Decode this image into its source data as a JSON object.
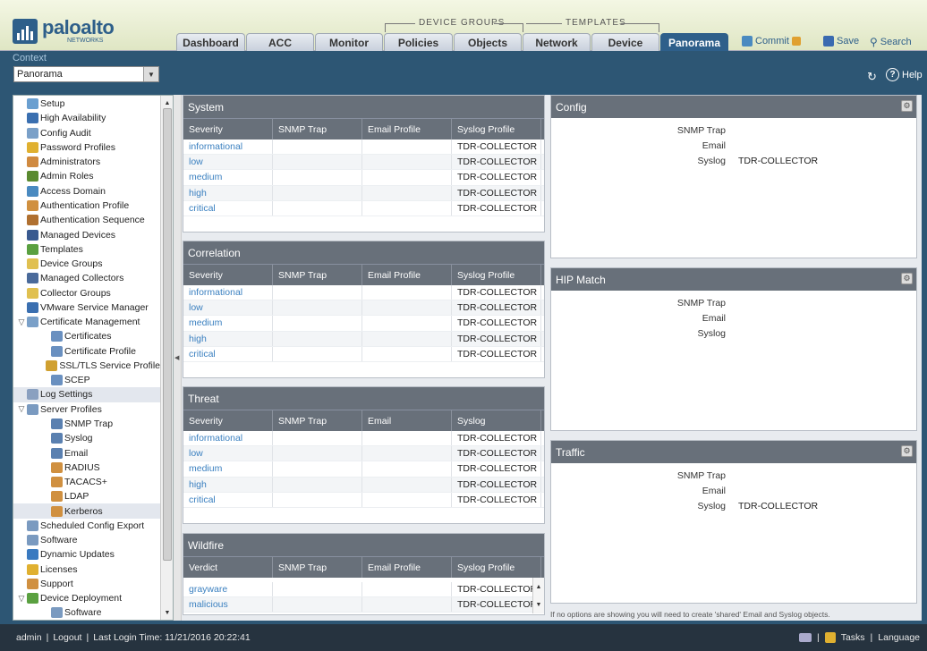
{
  "brand": {
    "name": "paloalto",
    "sub": "NETWORKS"
  },
  "tab_groups": {
    "device_groups": "DEVICE GROUPS",
    "templates": "TEMPLATES"
  },
  "tabs": [
    {
      "label": "Dashboard"
    },
    {
      "label": "ACC"
    },
    {
      "label": "Monitor"
    },
    {
      "label": "Policies"
    },
    {
      "label": "Objects"
    },
    {
      "label": "Network"
    },
    {
      "label": "Device"
    },
    {
      "label": "Panorama",
      "active": true
    }
  ],
  "toolbar": {
    "commit": "Commit",
    "save": "Save",
    "search": "Search"
  },
  "context": {
    "label": "Context",
    "value": "Panorama"
  },
  "help": "Help",
  "sidebar": {
    "items": [
      {
        "label": "Setup",
        "icon": "setup-icon",
        "indent": 0,
        "color": "#6a9fd0"
      },
      {
        "label": "High Availability",
        "icon": "ha-icon",
        "indent": 0,
        "color": "#3a6fb0"
      },
      {
        "label": "Config Audit",
        "icon": "audit-icon",
        "indent": 0,
        "color": "#7aa0c8"
      },
      {
        "label": "Password Profiles",
        "icon": "password-icon",
        "indent": 0,
        "color": "#e0b030"
      },
      {
        "label": "Administrators",
        "icon": "admin-icon",
        "indent": 0,
        "color": "#d08a40"
      },
      {
        "label": "Admin Roles",
        "icon": "roles-icon",
        "indent": 0,
        "color": "#5a8a30"
      },
      {
        "label": "Access Domain",
        "icon": "domain-icon",
        "indent": 0,
        "color": "#4a8ac0"
      },
      {
        "label": "Authentication Profile",
        "icon": "auth-profile-icon",
        "indent": 0,
        "color": "#d09040"
      },
      {
        "label": "Authentication Sequence",
        "icon": "auth-seq-icon",
        "indent": 0,
        "color": "#b07030"
      },
      {
        "label": "Managed Devices",
        "icon": "devices-icon",
        "indent": 0,
        "color": "#3a5a90"
      },
      {
        "label": "Templates",
        "icon": "templates-icon",
        "indent": 0,
        "color": "#5aa040"
      },
      {
        "label": "Device Groups",
        "icon": "device-groups-icon",
        "indent": 0,
        "color": "#e0c050"
      },
      {
        "label": "Managed Collectors",
        "icon": "collectors-icon",
        "indent": 0,
        "color": "#4a6a9a"
      },
      {
        "label": "Collector Groups",
        "icon": "collector-groups-icon",
        "indent": 0,
        "color": "#e0c050"
      },
      {
        "label": "VMware Service Manager",
        "icon": "vmware-icon",
        "indent": 0,
        "color": "#3a6fb0"
      },
      {
        "label": "Certificate Management",
        "icon": "cert-mgmt-icon",
        "indent": 0,
        "color": "#7aa0c8",
        "expanded": true
      },
      {
        "label": "Certificates",
        "icon": "certificate-icon",
        "indent": 1,
        "color": "#6a90c0"
      },
      {
        "label": "Certificate Profile",
        "icon": "cert-profile-icon",
        "indent": 1,
        "color": "#6a90c0"
      },
      {
        "label": "SSL/TLS Service Profile",
        "icon": "lock-icon",
        "indent": 1,
        "color": "#d0a030"
      },
      {
        "label": "SCEP",
        "icon": "scep-icon",
        "indent": 1,
        "color": "#6a90c0"
      },
      {
        "label": "Log Settings",
        "icon": "log-settings-icon",
        "indent": 0,
        "color": "#8aa0c0",
        "selected": true
      },
      {
        "label": "Server Profiles",
        "icon": "server-profiles-icon",
        "indent": 0,
        "color": "#7a9ac0",
        "expanded": true
      },
      {
        "label": "SNMP Trap",
        "icon": "snmp-icon",
        "indent": 1,
        "color": "#5a80b0"
      },
      {
        "label": "Syslog",
        "icon": "syslog-icon",
        "indent": 1,
        "color": "#5a80b0"
      },
      {
        "label": "Email",
        "icon": "email-icon",
        "indent": 1,
        "color": "#5a80b0"
      },
      {
        "label": "RADIUS",
        "icon": "radius-icon",
        "indent": 1,
        "color": "#d09040"
      },
      {
        "label": "TACACS+",
        "icon": "tacacs-icon",
        "indent": 1,
        "color": "#d09040"
      },
      {
        "label": "LDAP",
        "icon": "ldap-icon",
        "indent": 1,
        "color": "#d09040"
      },
      {
        "label": "Kerberos",
        "icon": "kerberos-icon",
        "indent": 1,
        "color": "#d09040",
        "selected": true
      },
      {
        "label": "Scheduled Config Export",
        "icon": "export-icon",
        "indent": 0,
        "color": "#7a9ac0"
      },
      {
        "label": "Software",
        "icon": "software-icon",
        "indent": 0,
        "color": "#7a9ac0"
      },
      {
        "label": "Dynamic Updates",
        "icon": "updates-icon",
        "indent": 0,
        "color": "#3a7ac0"
      },
      {
        "label": "Licenses",
        "icon": "licenses-icon",
        "indent": 0,
        "color": "#e0b030"
      },
      {
        "label": "Support",
        "icon": "support-icon",
        "indent": 0,
        "color": "#d09040"
      },
      {
        "label": "Device Deployment",
        "icon": "deployment-icon",
        "indent": 0,
        "color": "#5aa040",
        "expanded": true
      },
      {
        "label": "Software",
        "icon": "software-icon",
        "indent": 1,
        "color": "#7a9ac0"
      }
    ]
  },
  "panels": {
    "system": {
      "title": "System",
      "columns": [
        "Severity",
        "SNMP Trap",
        "Email Profile",
        "Syslog Profile"
      ],
      "rows": [
        {
          "severity": "informational",
          "snmp": "",
          "email": "",
          "syslog": "TDR-COLLECTOR"
        },
        {
          "severity": "low",
          "snmp": "",
          "email": "",
          "syslog": "TDR-COLLECTOR"
        },
        {
          "severity": "medium",
          "snmp": "",
          "email": "",
          "syslog": "TDR-COLLECTOR"
        },
        {
          "severity": "high",
          "snmp": "",
          "email": "",
          "syslog": "TDR-COLLECTOR"
        },
        {
          "severity": "critical",
          "snmp": "",
          "email": "",
          "syslog": "TDR-COLLECTOR"
        }
      ]
    },
    "correlation": {
      "title": "Correlation",
      "columns": [
        "Severity",
        "SNMP Trap",
        "Email Profile",
        "Syslog Profile"
      ],
      "rows": [
        {
          "severity": "informational",
          "snmp": "",
          "email": "",
          "syslog": "TDR-COLLECTOR"
        },
        {
          "severity": "low",
          "snmp": "",
          "email": "",
          "syslog": "TDR-COLLECTOR"
        },
        {
          "severity": "medium",
          "snmp": "",
          "email": "",
          "syslog": "TDR-COLLECTOR"
        },
        {
          "severity": "high",
          "snmp": "",
          "email": "",
          "syslog": "TDR-COLLECTOR"
        },
        {
          "severity": "critical",
          "snmp": "",
          "email": "",
          "syslog": "TDR-COLLECTOR"
        }
      ]
    },
    "threat": {
      "title": "Threat",
      "columns": [
        "Severity",
        "SNMP Trap",
        "Email",
        "Syslog"
      ],
      "rows": [
        {
          "severity": "informational",
          "snmp": "",
          "email": "",
          "syslog": "TDR-COLLECTOR"
        },
        {
          "severity": "low",
          "snmp": "",
          "email": "",
          "syslog": "TDR-COLLECTOR"
        },
        {
          "severity": "medium",
          "snmp": "",
          "email": "",
          "syslog": "TDR-COLLECTOR"
        },
        {
          "severity": "high",
          "snmp": "",
          "email": "",
          "syslog": "TDR-COLLECTOR"
        },
        {
          "severity": "critical",
          "snmp": "",
          "email": "",
          "syslog": "TDR-COLLECTOR"
        }
      ]
    },
    "wildfire": {
      "title": "Wildfire",
      "columns": [
        "Verdict",
        "SNMP Trap",
        "Email Profile",
        "Syslog Profile"
      ],
      "rows": [
        {
          "severity": "grayware",
          "snmp": "",
          "email": "",
          "syslog": "TDR-COLLECTOR"
        },
        {
          "severity": "malicious",
          "snmp": "",
          "email": "",
          "syslog": "TDR-COLLECTOR"
        }
      ]
    },
    "config": {
      "title": "Config",
      "labels": [
        "SNMP Trap",
        "Email",
        "Syslog"
      ],
      "values": [
        "",
        "",
        "TDR-COLLECTOR"
      ]
    },
    "hip": {
      "title": "HIP Match",
      "labels": [
        "SNMP Trap",
        "Email",
        "Syslog"
      ],
      "values": [
        "",
        "",
        ""
      ]
    },
    "traffic": {
      "title": "Traffic",
      "labels": [
        "SNMP Trap",
        "Email",
        "Syslog"
      ],
      "values": [
        "",
        "",
        "TDR-COLLECTOR"
      ]
    }
  },
  "footnote": "If no options are showing you will need to create 'shared' Email and Syslog objects.",
  "footer": {
    "user": "admin",
    "logout": "Logout",
    "last_login": "Last Login Time: 11/21/2016 20:22:41",
    "tasks": "Tasks",
    "language": "Language"
  }
}
